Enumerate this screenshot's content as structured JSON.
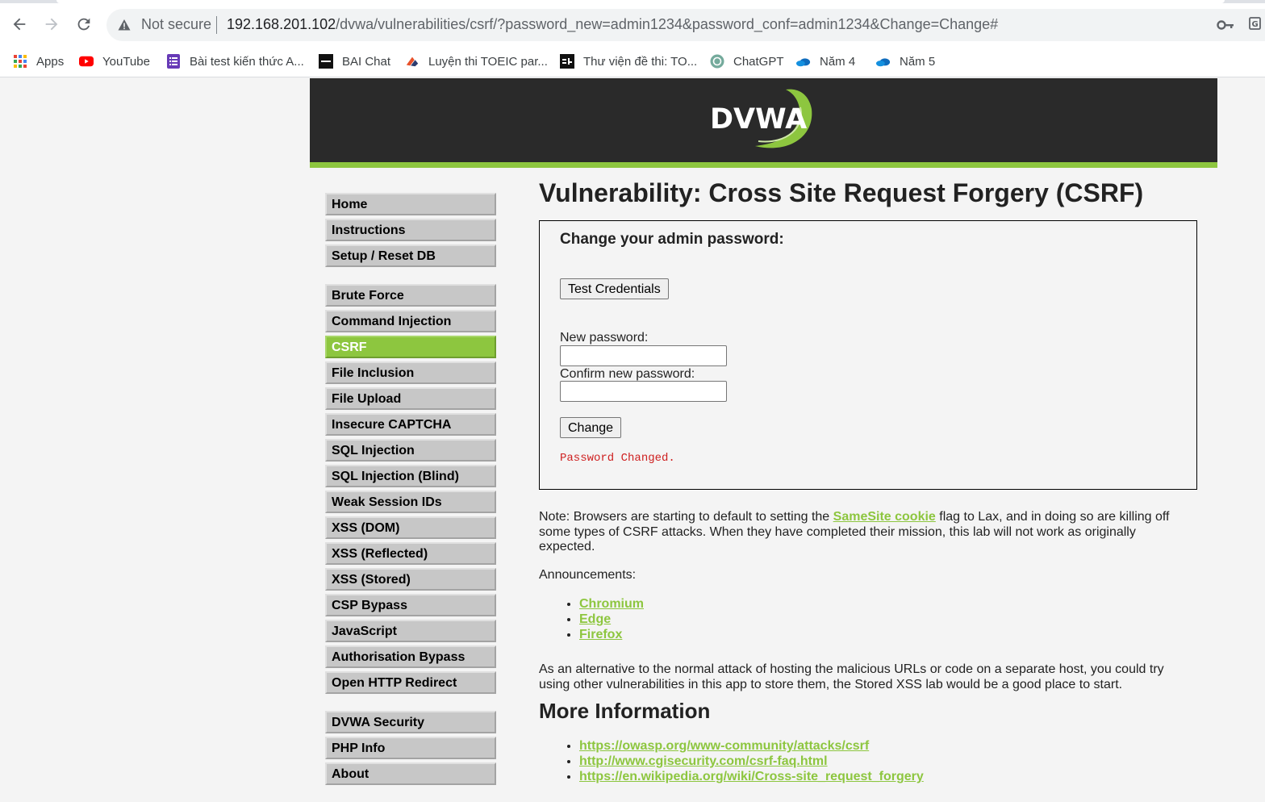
{
  "browser": {
    "not_secure_label": "Not secure",
    "url_host": "192.168.201.102",
    "url_rest": "/dvwa/vulnerabilities/csrf/?password_new=admin1234&password_conf=admin1234&Change=Change#",
    "bookmarks": [
      {
        "label": "Apps",
        "icon": "apps-grid-icon"
      },
      {
        "label": "YouTube",
        "icon": "youtube-icon"
      },
      {
        "label": "Bài test kiến thức A...",
        "icon": "forms-icon"
      },
      {
        "label": "BAI Chat",
        "icon": "bai-chat-icon"
      },
      {
        "label": "Luyện thi TOEIC par...",
        "icon": "toeic-icon"
      },
      {
        "label": "Thư viện đề thi: TO...",
        "icon": "s4-icon"
      },
      {
        "label": "ChatGPT",
        "icon": "chatgpt-icon"
      },
      {
        "label": "Năm 4",
        "icon": "onedrive-icon"
      },
      {
        "label": "Năm 5",
        "icon": "onedrive-icon"
      }
    ]
  },
  "logo_text": "DVWA",
  "menu": {
    "group1": [
      "Home",
      "Instructions",
      "Setup / Reset DB"
    ],
    "group2": [
      "Brute Force",
      "Command Injection",
      "CSRF",
      "File Inclusion",
      "File Upload",
      "Insecure CAPTCHA",
      "SQL Injection",
      "SQL Injection (Blind)",
      "Weak Session IDs",
      "XSS (DOM)",
      "XSS (Reflected)",
      "XSS (Stored)",
      "CSP Bypass",
      "JavaScript",
      "Authorisation Bypass",
      "Open HTTP Redirect"
    ],
    "group3": [
      "DVWA Security",
      "PHP Info",
      "About"
    ],
    "active": "CSRF"
  },
  "main": {
    "title": "Vulnerability: Cross Site Request Forgery (CSRF)",
    "box_heading": "Change your admin password:",
    "test_button": "Test Credentials",
    "new_password_label": "New password:",
    "confirm_password_label": "Confirm new password:",
    "change_button": "Change",
    "status": "Password Changed.",
    "note_prefix": "Note: Browsers are starting to default to setting the ",
    "note_link": "SameSite cookie",
    "note_suffix": " flag to Lax, and in doing so are killing off some types of CSRF attacks. When they have completed their mission, this lab will not work as originally expected.",
    "announcements_label": "Announcements:",
    "announcements": [
      "Chromium",
      "Edge",
      "Firefox"
    ],
    "alternative_text": "As an alternative to the normal attack of hosting the malicious URLs or code on a separate host, you could try using other vulnerabilities in this app to store them, the Stored XSS lab would be a good place to start.",
    "more_info_title": "More Information",
    "more_info_links": [
      "https://owasp.org/www-community/attacks/csrf",
      "http://www.cgisecurity.com/csrf-faq.html",
      "https://en.wikipedia.org/wiki/Cross-site_request_forgery"
    ]
  },
  "colors": {
    "accent_green": "#8dc63f",
    "header_dark": "#2a2a2a",
    "status_red": "#ce1f1f"
  }
}
